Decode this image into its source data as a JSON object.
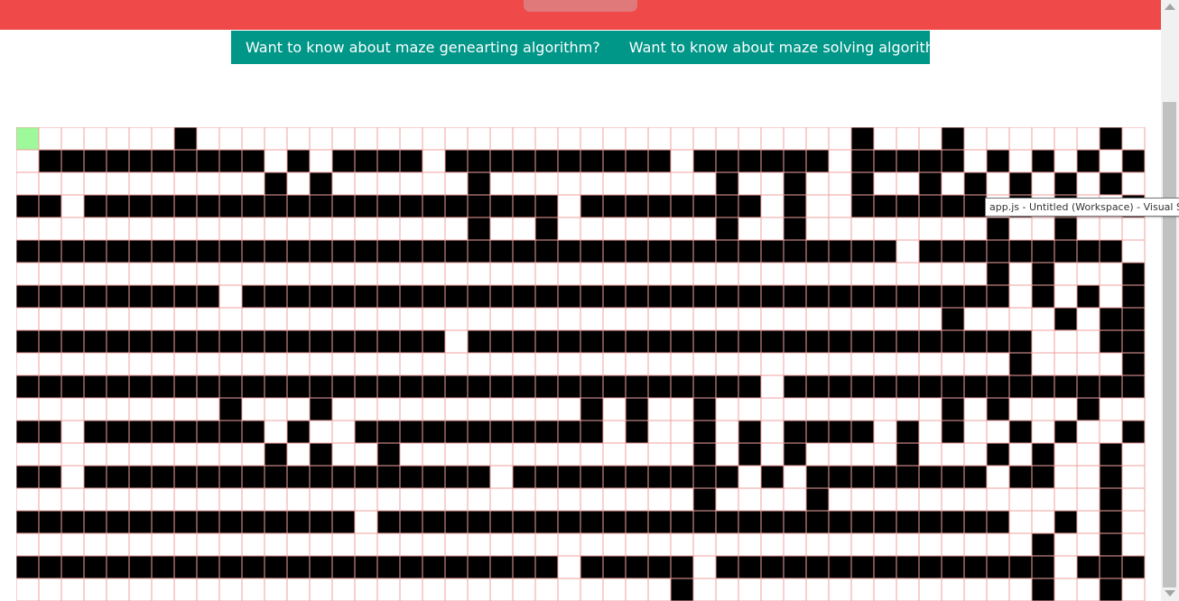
{
  "links": {
    "generating": "Want to know about maze genearting algorithm?",
    "solving": "Want to know about maze solving algorithm?"
  },
  "tooltip": {
    "text": "app.js - Untitled (Workspace) - Visual Stu"
  },
  "maze": {
    "columns": 50,
    "rows_visible": 21,
    "colors": {
      "open": "#ffffff",
      "wall": "#000000",
      "grid_line": "#f0a0a0",
      "start": "#9ef99a",
      "end": "#111111"
    },
    "legend": "0 = open cell, 1 = wall, S = start (green), E = end (dark)",
    "grid": [
      "S000000100000000000000000000000000000100010000001000",
      "01111111111010111101111111111011111101111101010101001",
      "00000000000101000000100000000001001001001010101010001",
      "11011111111111111111111101111111101001111110101001001",
      "00000000000000000000100100000001001000000001001000000",
      "11111111111111111111111111111111111111101111111110111",
      "00000000000000000000000000000000000000000001010001010",
      "11111111101111111111111111111111111111111111010101011",
      "00000000000000000000000000000000000000000100001011101",
      "11111111111111111110111111111111111111111111100011101",
      "00000000000000000000000000000000000000000000100001000",
      "11111111111111111111111111111111101111111111111111101",
      "00000000010001000000000001010010000000000101000100101",
      "11011111111010011111111111010010101111010100101001000",
      "00000000000101001000000000000010101000010001010010100",
      "11011111111111111111101111111111010111111110110010101",
      "00000000000000000000000000000010000100000000000010101",
      "11111111111111101111111111111111111111111111001010101",
      "00000000000000000000000000000000000000000000010010101",
      "11111111111111111111111101111101111111111111110111101",
      "00000000000000000000000000000100000000000000010010E0"
    ]
  }
}
